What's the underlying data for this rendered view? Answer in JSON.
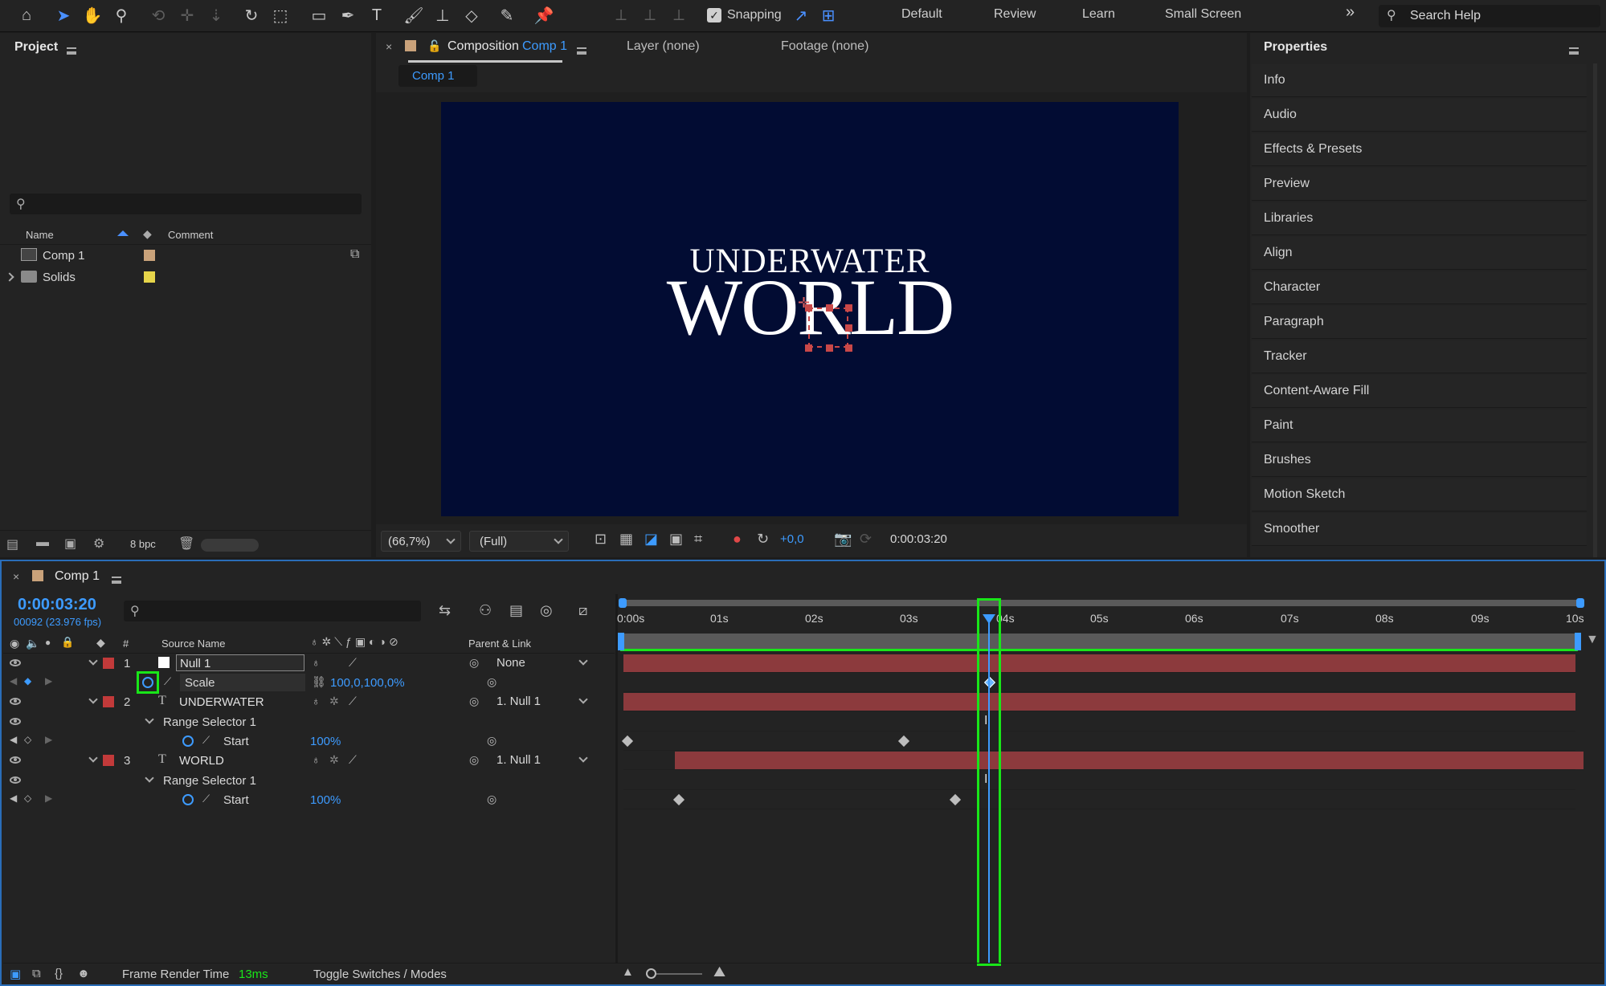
{
  "toolbar": {
    "snapping_label": "Snapping",
    "snapping_checked": true,
    "workspaces": [
      "Default",
      "Review",
      "Learn",
      "Small Screen"
    ],
    "more": "»",
    "search_placeholder": "Search Help"
  },
  "project": {
    "title": "Project",
    "col_name": "Name",
    "col_comment": "Comment",
    "items": [
      {
        "name": "Comp 1",
        "color": "#c9a27a"
      },
      {
        "name": "Solids",
        "color": "#e6d54a"
      }
    ],
    "bpc": "8 bpc"
  },
  "composition": {
    "tab_prefix": "Composition",
    "tab_name": "Comp 1",
    "layer_tab": "Layer (none)",
    "footage_tab": "Footage (none)",
    "subtab": "Comp 1",
    "title_line1": "UNDERWATER",
    "title_line2": "WORLD",
    "zoom": "(66,7%)",
    "resolution": "(Full)",
    "exposure": "+0,0",
    "timecode": "0:00:03:20",
    "bg_color": "#020c33"
  },
  "properties": {
    "title": "Properties",
    "items": [
      "Info",
      "Audio",
      "Effects & Presets",
      "Preview",
      "Libraries",
      "Align",
      "Character",
      "Paragraph",
      "Tracker",
      "Content-Aware Fill",
      "Paint",
      "Brushes",
      "Motion Sketch",
      "Smoother"
    ]
  },
  "timeline": {
    "tab": "Comp 1",
    "timecode": "0:00:03:20",
    "frame_info": "00092 (23.976 fps)",
    "col_hash": "#",
    "col_source": "Source Name",
    "col_parent": "Parent & Link",
    "layers": [
      {
        "num": "1",
        "name": "Null 1",
        "parent": "None",
        "color": "#c23a3a"
      },
      {
        "num": "2",
        "name": "UNDERWATER",
        "parent": "1. Null 1",
        "color": "#c23a3a"
      },
      {
        "num": "3",
        "name": "WORLD",
        "parent": "1. Null 1",
        "color": "#c23a3a"
      }
    ],
    "scale_label": "Scale",
    "scale_value": "100,0,100,0%",
    "range_selector": "Range Selector 1",
    "start_label": "Start",
    "start_value": "100%",
    "ruler": [
      "0:00s",
      "01s",
      "02s",
      "03s",
      "04s",
      "05s",
      "06s",
      "07s",
      "08s",
      "09s",
      "10s"
    ],
    "footer_render": "Frame Render Time",
    "footer_render_value": "13ms",
    "footer_toggle": "Toggle Switches / Modes"
  }
}
